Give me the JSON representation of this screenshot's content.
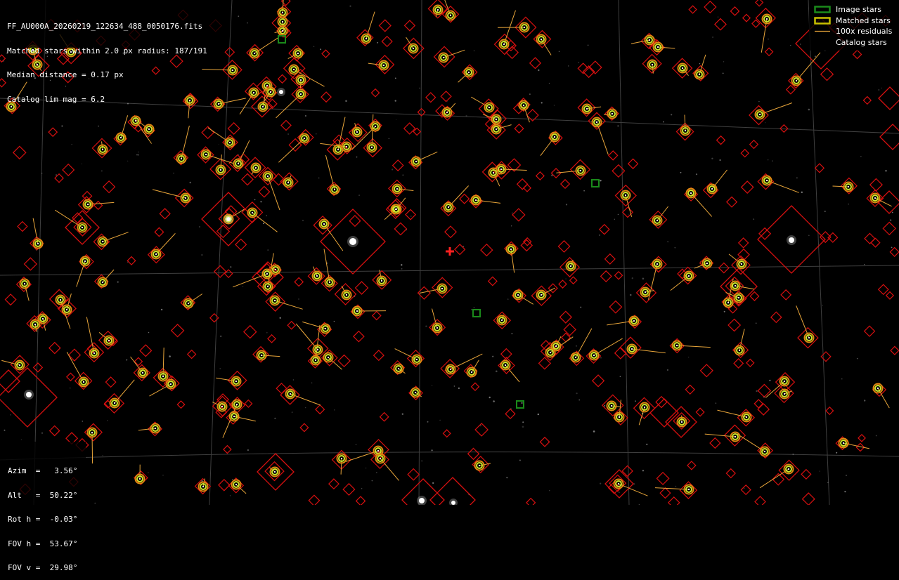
{
  "info": {
    "filename": "FF_AU000A_20260219_122634_488_0050176.fits",
    "matched": "Matched stars within 2.0 px radius: 187/191",
    "median": "Median distance = 0.17 px",
    "lim_mag": "Catalog lim mag = 6.2"
  },
  "pointing": {
    "azim": "Azim  =   3.56°",
    "alt": "Alt   =  50.22°",
    "rot": "Rot h =  -0.03°",
    "fov_h": "FOV h =  53.67°",
    "fov_v": "FOV v =  29.98°"
  },
  "legend": {
    "image_stars": "Image stars",
    "matched_stars": "Matched stars",
    "residuals": "100x residuals",
    "catalog_stars": "Catalog stars"
  },
  "colors": {
    "background": "#000000",
    "grid": "#5a5a5a",
    "catalog": "#d81010",
    "image_star": "#1a8a1a",
    "matched_outer": "#e08a10",
    "matched_inner": "#c8e62a",
    "residual": "#e8a53a",
    "center_marker": "#ff2020"
  }
}
